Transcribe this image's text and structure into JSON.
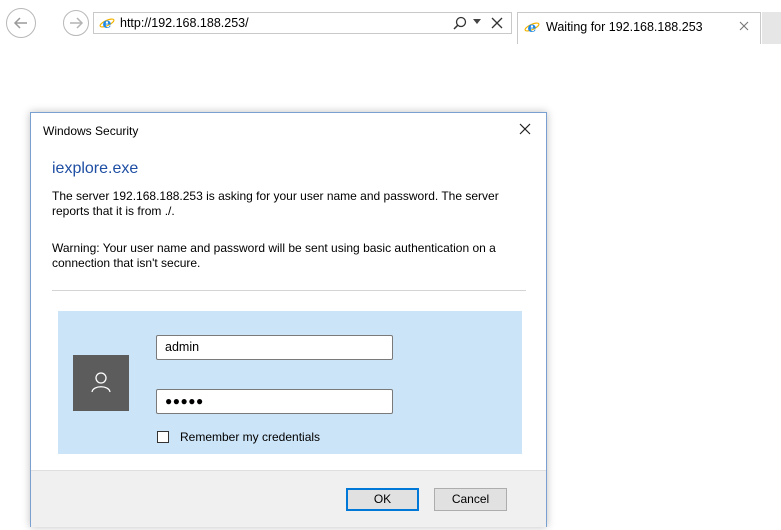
{
  "browser": {
    "address": {
      "url": "http://192.168.188.253/"
    },
    "tab": {
      "title": "Waiting for 192.168.188.253"
    },
    "icons": {
      "back": "back-arrow-icon",
      "forward": "forward-arrow-icon",
      "site": "internet-explorer-icon",
      "search": "search-icon",
      "dropdown": "chevron-down-icon",
      "stop": "close-icon",
      "tab_close": "close-icon"
    }
  },
  "dialog": {
    "title": "Windows Security",
    "app_name": "iexplore.exe",
    "message": "The server 192.168.188.253 is asking for your user name and password. The server reports that it is from ./.",
    "warning": "Warning: Your user name and password will be sent using basic authentication on a connection that isn't secure.",
    "username_value": "admin",
    "password_value": "●●●●●",
    "remember_label": "Remember my credentials",
    "remember_checked": false,
    "ok_label": "OK",
    "cancel_label": "Cancel",
    "avatar_icon": "user-icon",
    "colors": {
      "accent": "#0078d7",
      "app_name": "#1f4fa3",
      "panel": "#cce4f7",
      "avatar": "#5c5c5c"
    }
  }
}
